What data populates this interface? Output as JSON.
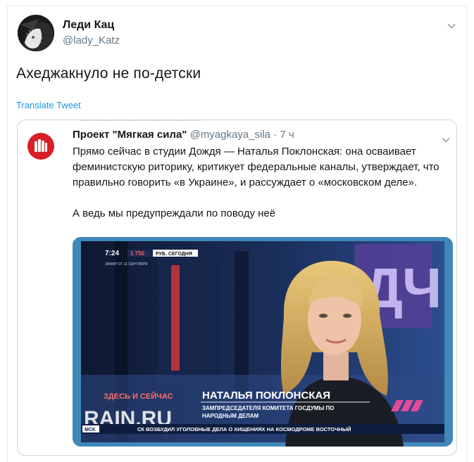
{
  "author": {
    "name": "Леди Кац",
    "handle": "@lady_Katz"
  },
  "tweet": {
    "text": "Ахеджакнуло не по-детски",
    "translate_label": "Translate Tweet"
  },
  "quoted": {
    "name": "Проект \"Мягкая сила\"",
    "meta": "@myagkaya_sila · 7 ч",
    "paragraphs": [
      "Прямо сейчас в студии Дождя — Наталья Поклонская: она осваивает феминистскую риторику, критикует федеральные каналы, утверждает, что правильно говорить «в Украине», и рассуждает о «московском деле».",
      "А ведь мы предупреждали по поводу неё"
    ]
  },
  "broadcast": {
    "clock": "7:24",
    "price": "1 750",
    "price_caption": "РУБ. СЕГОДНЯ",
    "date_line": "ЗАФИР ОТ 11 СЕНТЯБРЯ",
    "segment": "ЗДЕСЬ И СЕЙЧАС",
    "channel_logo": "RAIN.RU",
    "guest_name": "НАТАЛЬЯ ПОКЛОНСКАЯ",
    "guest_title_1": "ЗАМПРЕДСЕДАТЕЛЯ КОМИТЕТА ГОСДУМЫ ПО",
    "guest_title_2": "НАРОДНЫМ ДЕЛАМ",
    "ticker_tag": "МСК",
    "ticker_text": "СК ВОЗБУДИЛ УГОЛОВНЫЕ ДЕЛА О ХИЩЕНИЯХ НА КОСМОДРОМЕ ВОСТОЧНЫЙ",
    "backdrop_letters": "ДЧ"
  },
  "colors": {
    "link": "#1b95e0",
    "muted": "#657786",
    "brand_red": "#d81f26"
  }
}
